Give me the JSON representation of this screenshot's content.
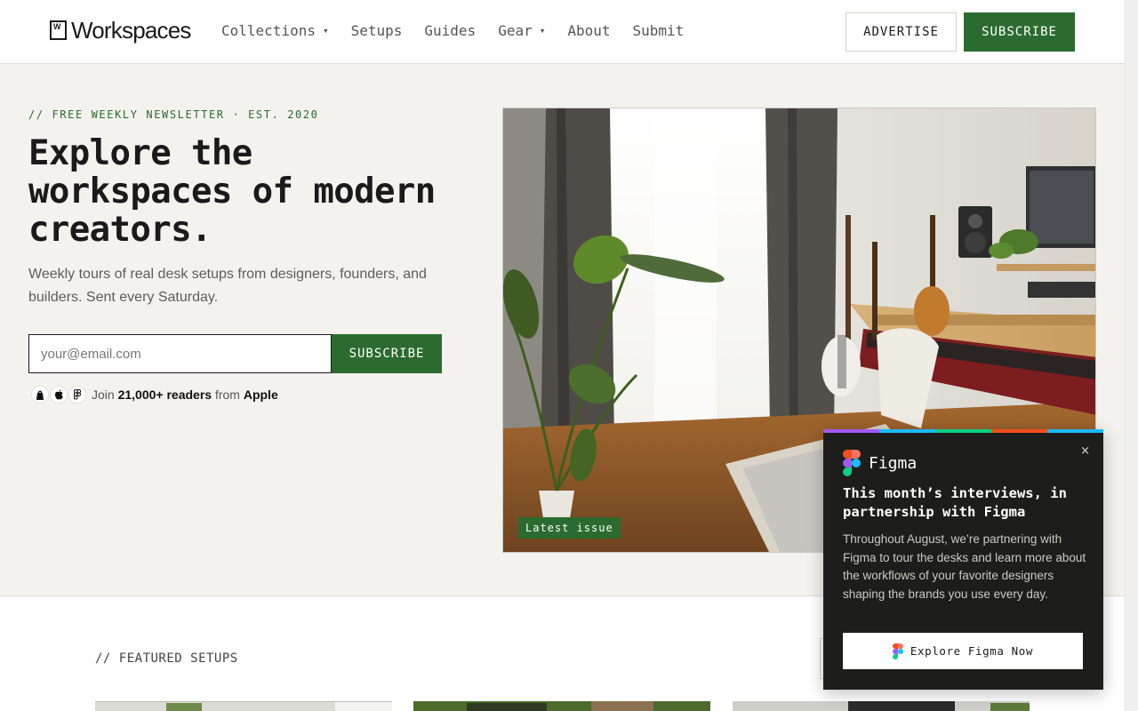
{
  "header": {
    "logo_mark": "W",
    "logo_text": "Workspaces",
    "nav": [
      {
        "label": "Collections",
        "has_dropdown": true
      },
      {
        "label": "Setups",
        "has_dropdown": false
      },
      {
        "label": "Guides",
        "has_dropdown": false
      },
      {
        "label": "Gear",
        "has_dropdown": true
      },
      {
        "label": "About",
        "has_dropdown": false
      },
      {
        "label": "Submit",
        "has_dropdown": false
      }
    ],
    "caret": "▾",
    "advertise_label": "ADVERTISE",
    "subscribe_label": "SUBSCRIBE"
  },
  "hero": {
    "eyebrow": "// FREE WEEKLY NEWSLETTER · EST. 2020",
    "title": "Explore the workspaces of modern creators.",
    "subtitle": "Weekly tours of real desk setups from designers, founders, and builders. Sent every Saturday.",
    "email_placeholder": "your@email.com",
    "subscribe_label": "SUBSCRIBE",
    "readers": {
      "prefix": "Join",
      "count": "21,000+ readers",
      "middle": "from",
      "company": "Apple",
      "avatars": [
        "shopify-icon",
        "apple-icon",
        "figma-icon"
      ]
    },
    "image_badge": "Latest issue"
  },
  "featured": {
    "label": "// FEATURED SETUPS"
  },
  "popup": {
    "brand": "Figma",
    "close": "×",
    "title": "This month’s interviews, in partnership with Figma",
    "body": "Throughout August, we’re partnering with Figma to tour the desks and learn more about the workflows of your favorite designers shaping the brands you use every day.",
    "cta": "Explore Figma Now",
    "stripe_colors": [
      "#a259ff",
      "#1abcfe",
      "#0acf83",
      "#f24e1e",
      "#1abcfe"
    ]
  },
  "colors": {
    "accent": "#2c6b2f",
    "page_bg": "#f3f2ee",
    "popup_bg": "#1d1d1b"
  }
}
